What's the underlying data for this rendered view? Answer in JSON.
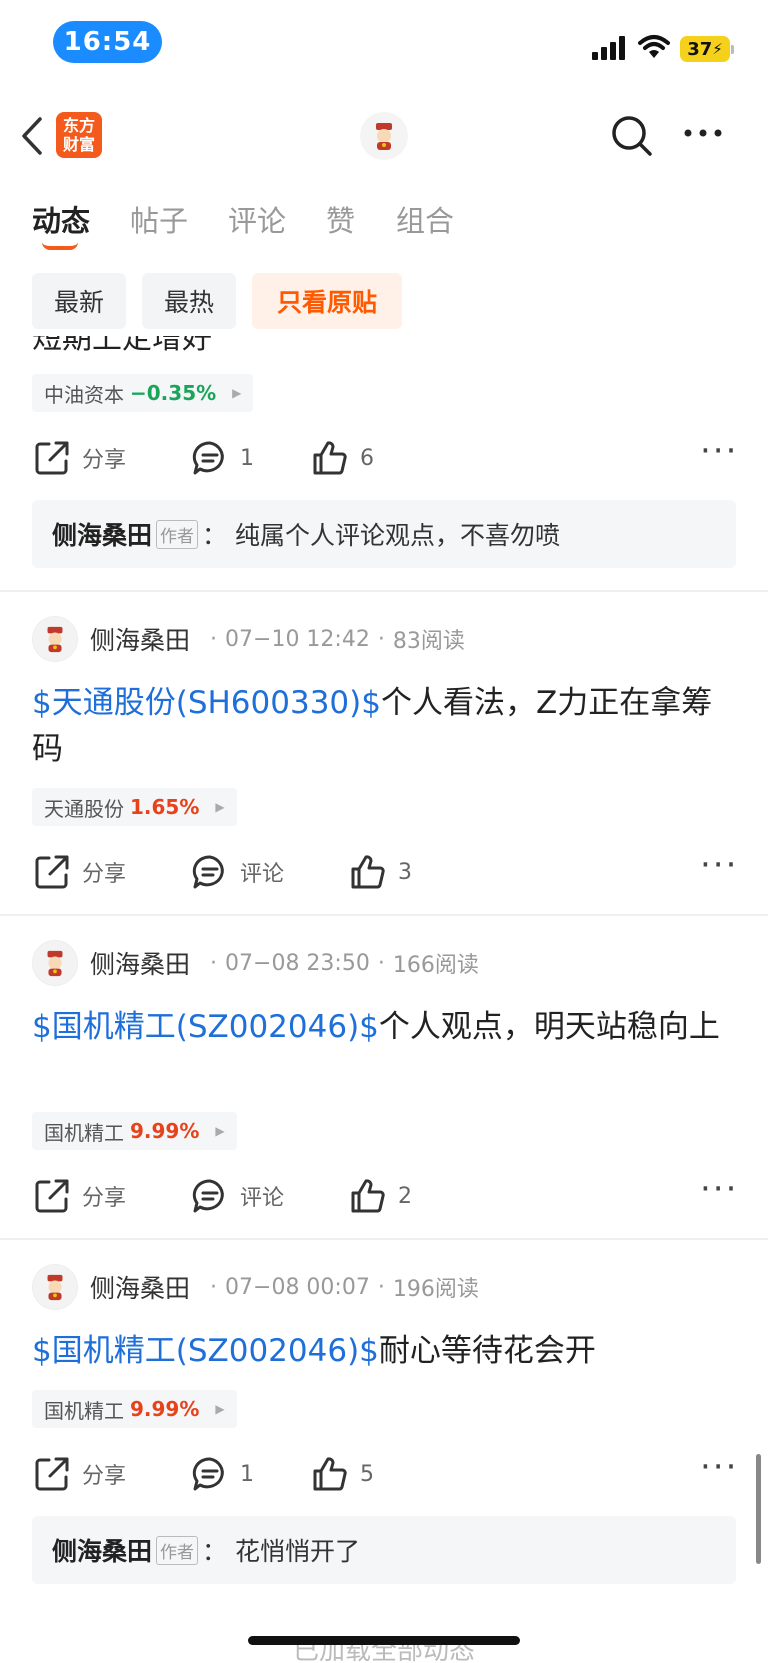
{
  "status_bar": {
    "time": "16:54",
    "battery": "37"
  },
  "header": {
    "logo_text": "东方\n财富"
  },
  "tabs": [
    {
      "label": "动态",
      "active": true
    },
    {
      "label": "帖子"
    },
    {
      "label": "评论"
    },
    {
      "label": "赞"
    },
    {
      "label": "组合"
    }
  ],
  "filters": [
    {
      "label": "最新"
    },
    {
      "label": "最热"
    },
    {
      "label": "只看原贴",
      "active": true
    }
  ],
  "posts": [
    {
      "clipped_text": "短期上定增好",
      "stock_tag": {
        "name": "中油资本",
        "change": "−0.35%",
        "direction": "down"
      },
      "share_label": "分享",
      "comment_label": "1",
      "like_count": "6",
      "reply": {
        "author": "侧海桑田",
        "badge": "作者",
        "sep": "：",
        "text": "纯属个人评论观点，不喜勿喷"
      }
    },
    {
      "author": "侧海桑田",
      "time": "07−10 12:42",
      "reads": "83阅读",
      "stock_link": "$天通股份(SH600330)$",
      "text": "个人看法，Z力正在拿筹码",
      "stock_tag": {
        "name": "天通股份",
        "change": "1.65%",
        "direction": "up"
      },
      "share_label": "分享",
      "comment_label": "评论",
      "like_count": "3"
    },
    {
      "author": "侧海桑田",
      "time": "07−08 23:50",
      "reads": "166阅读",
      "stock_link": "$国机精工(SZ002046)$",
      "text": "个人观点，明天站稳向上",
      "stock_tag": {
        "name": "国机精工",
        "change": "9.99%",
        "direction": "up"
      },
      "share_label": "分享",
      "comment_label": "评论",
      "like_count": "2"
    },
    {
      "author": "侧海桑田",
      "time": "07−08 00:07",
      "reads": "196阅读",
      "stock_link": "$国机精工(SZ002046)$",
      "text": "耐心等待花会开",
      "stock_tag": {
        "name": "国机精工",
        "change": "9.99%",
        "direction": "up"
      },
      "share_label": "分享",
      "comment_label": "1",
      "like_count": "5",
      "reply": {
        "author": "侧海桑田",
        "badge": "作者",
        "sep": "：",
        "text": "花悄悄开了"
      }
    }
  ],
  "footer": {
    "text": "已加载全部动态"
  },
  "colors": {
    "accent": "#f35a1b",
    "link": "#1e6fd9",
    "up": "#e8421b",
    "down": "#1aa55a"
  }
}
